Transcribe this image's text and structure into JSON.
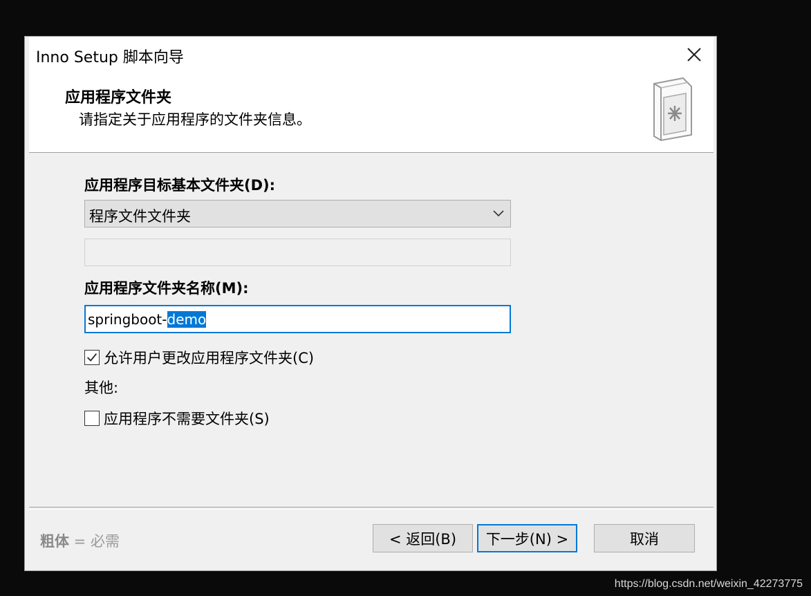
{
  "window": {
    "title": "Inno Setup 脚本向导"
  },
  "header": {
    "title": "应用程序文件夹",
    "subtitle": "请指定关于应用程序的文件夹信息。",
    "icon": "folder-document-icon"
  },
  "base_folder": {
    "label": "应用程序目标基本文件夹(D):",
    "selected": "程序文件文件夹",
    "custom_value": ""
  },
  "folder_name": {
    "label": "应用程序文件夹名称(M):",
    "value_prefix": "springboot-",
    "value_selected": "demo"
  },
  "options": {
    "allow_change": {
      "label": "允许用户更改应用程序文件夹(C)",
      "checked": true
    },
    "other_label": "其他:",
    "no_folder": {
      "label": "应用程序不需要文件夹(S)",
      "checked": false
    }
  },
  "footer": {
    "note_bold": "粗体",
    "note_rest": " = 必需",
    "back_label": "< 返回(B)",
    "next_label": "下一步(N) >",
    "cancel_label": "取消"
  },
  "watermark": "https://blog.csdn.net/weixin_42273775",
  "colors": {
    "accent": "#0078d7",
    "dialog_bg": "#f0f0f0",
    "backdrop": "#0a0a0a"
  }
}
